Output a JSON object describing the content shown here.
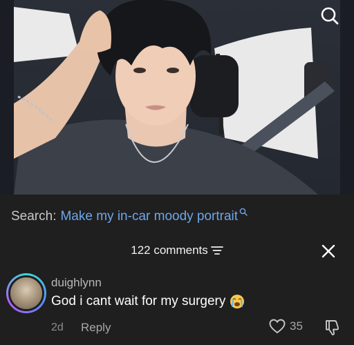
{
  "search": {
    "prefix": "Search:",
    "query": "Make my in-car moody portrait"
  },
  "comments_header": {
    "title": "122 comments"
  },
  "comment": {
    "username": "duighlynn",
    "text": "God i cant wait for my surgery",
    "emoji": "loudly-crying-face",
    "time": "2d",
    "reply_label": "Reply",
    "like_count": "35"
  },
  "icons": {
    "top_search": "search-icon",
    "inline_search": "search-icon",
    "sort": "sort-lines-icon",
    "close": "close-icon",
    "like": "heart-outline-icon",
    "dislike": "thumbs-down-icon"
  },
  "colors": {
    "background": "#1f1f1f",
    "search_accent": "#6fa6ec",
    "muted_text": "#a8a8a8"
  }
}
